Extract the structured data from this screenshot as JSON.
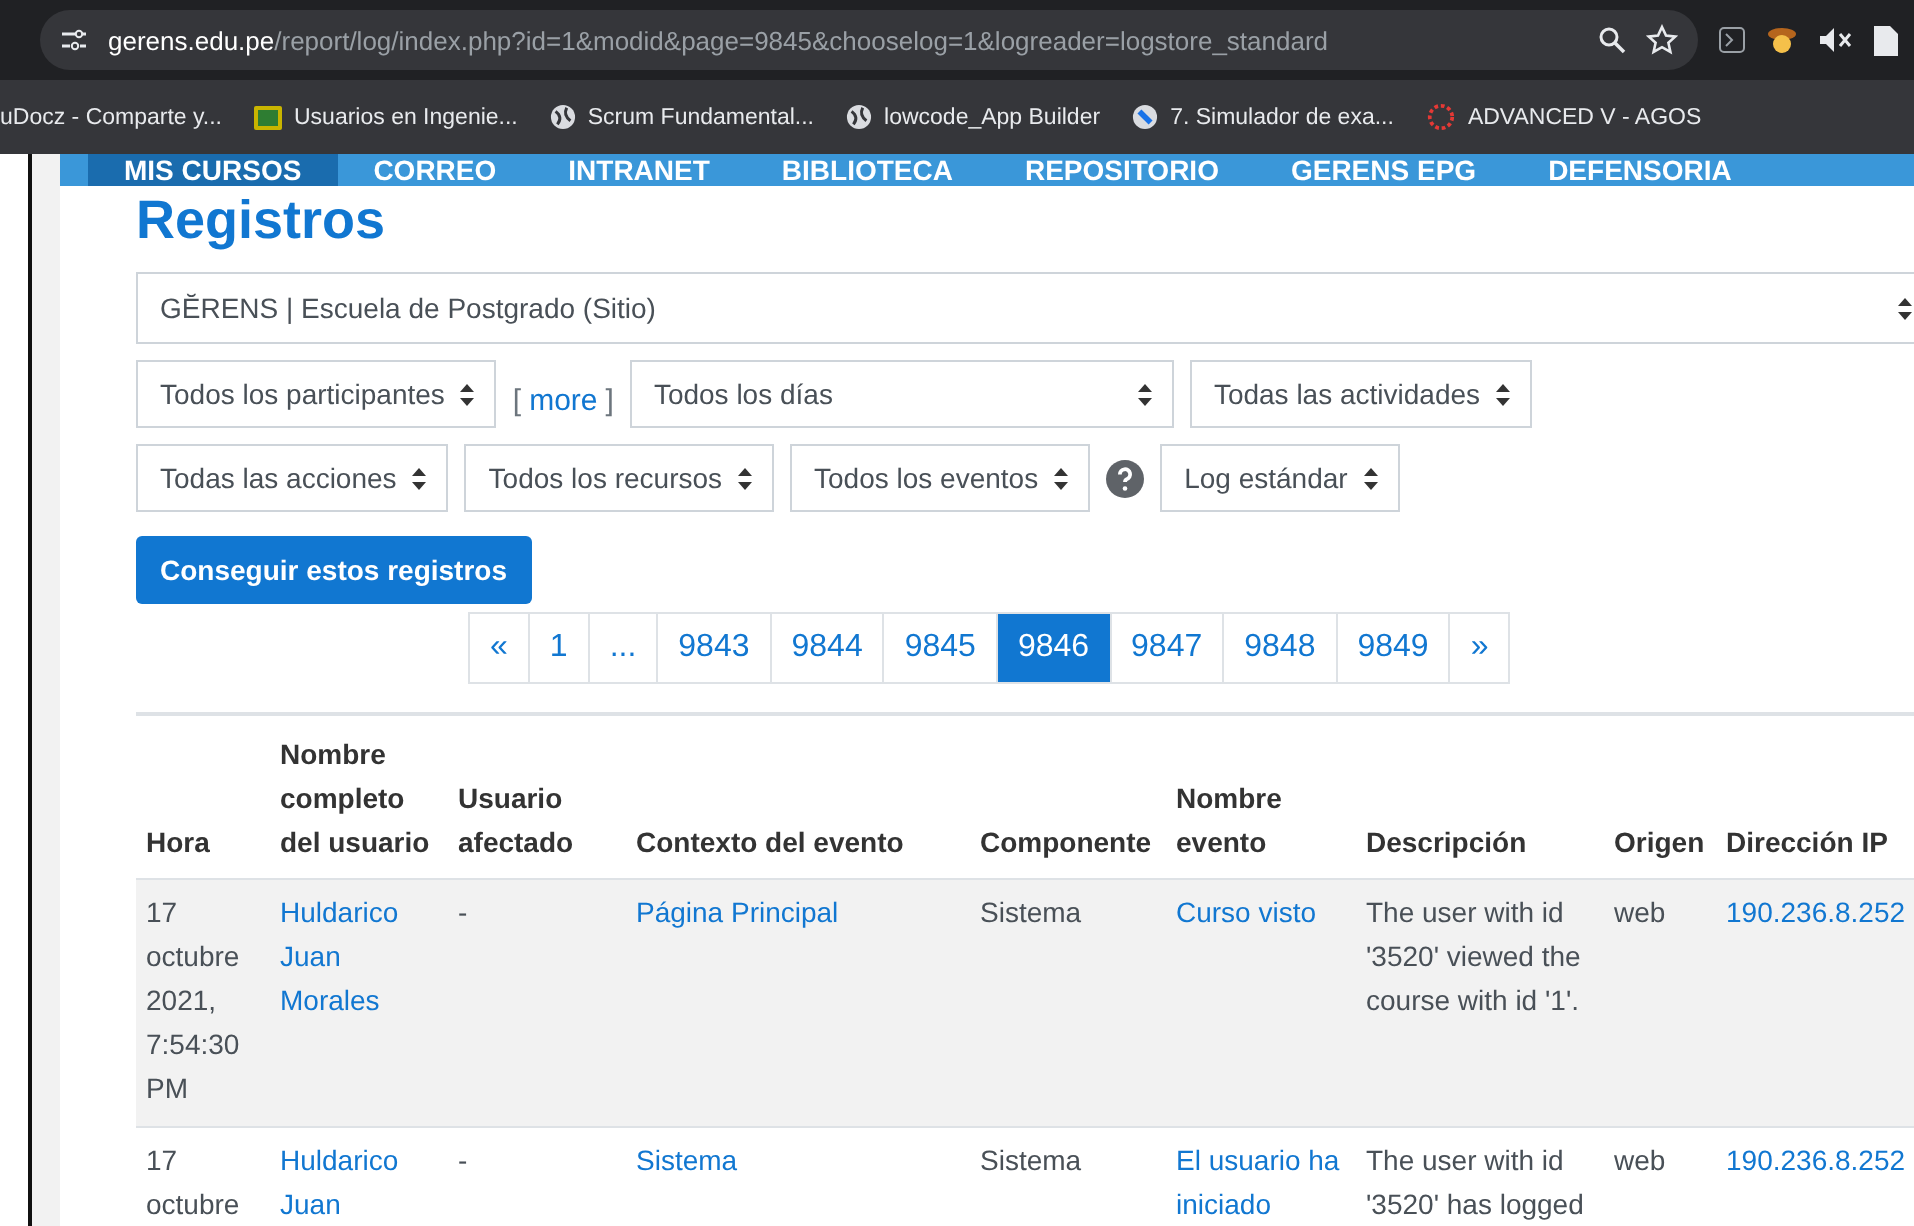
{
  "browser": {
    "address_host": "gerens.edu.pe",
    "address_path": "/report/log/index.php?id=1&modid&page=9845&chooselog=1&logreader=logstore_standard",
    "bookmarks": [
      {
        "label": "uDocz - Comparte y...",
        "kind": "none"
      },
      {
        "label": "Usuarios en Ingenie...",
        "kind": "image"
      },
      {
        "label": "Scrum Fundamental...",
        "kind": "globe"
      },
      {
        "label": "lowcode_App Builder",
        "kind": "globe"
      },
      {
        "label": "7. Simulador de exa...",
        "kind": "disc"
      },
      {
        "label": "ADVANCED V - AGOS",
        "kind": "ring"
      }
    ]
  },
  "nav": [
    {
      "label": "MIS CURSOS",
      "selected": true
    },
    {
      "label": "CORREO",
      "selected": false
    },
    {
      "label": "INTRANET",
      "selected": false
    },
    {
      "label": "BIBLIOTECA",
      "selected": false
    },
    {
      "label": "REPOSITORIO",
      "selected": false
    },
    {
      "label": "GERENS EPG",
      "selected": false
    },
    {
      "label": "DEFENSORIA",
      "selected": false
    }
  ],
  "title": "Registros",
  "site_select": "GĔRENS | Escuela de Postgrado (Sitio)",
  "filter_rows": [
    [
      {
        "kind": "select",
        "label": "Todos los participantes"
      },
      {
        "kind": "link",
        "label": "more",
        "open": "[",
        "close": "]"
      },
      {
        "kind": "wide",
        "label": "Todos los días"
      },
      {
        "kind": "select",
        "label": "Todas las actividades"
      }
    ],
    [
      {
        "kind": "select",
        "label": "Todas las acciones"
      },
      {
        "kind": "select",
        "label": "Todos los recursos"
      },
      {
        "kind": "select",
        "label": "Todos los eventos"
      },
      {
        "kind": "help"
      },
      {
        "kind": "select",
        "label": "Log estándar"
      }
    ]
  ],
  "submit": "Conseguir estos registros",
  "pagination": [
    {
      "label": "«",
      "selected": false
    },
    {
      "label": "1",
      "selected": false
    },
    {
      "label": "...",
      "selected": false
    },
    {
      "label": "9843",
      "selected": false
    },
    {
      "label": "9844",
      "selected": false
    },
    {
      "label": "9845",
      "selected": false
    },
    {
      "label": "9846",
      "selected": true
    },
    {
      "label": "9847",
      "selected": false
    },
    {
      "label": "9848",
      "selected": false
    },
    {
      "label": "9849",
      "selected": false
    },
    {
      "label": "»",
      "selected": false
    }
  ],
  "table": {
    "columns": [
      "Hora",
      "Nombre completo del usuario",
      "Usuario afectado",
      "Contexto del evento",
      "Componente",
      "Nombre evento",
      "Descripción",
      "Origen",
      "Dirección IP"
    ],
    "rows": [
      {
        "shaded": true,
        "cells": [
          {
            "kind": "text",
            "text": "17 octubre 2021, 7:54:30 PM"
          },
          {
            "kind": "link",
            "text": "Huldarico Juan Morales"
          },
          {
            "kind": "text",
            "text": "-"
          },
          {
            "kind": "link",
            "text": "Página Principal"
          },
          {
            "kind": "text",
            "text": "Sistema"
          },
          {
            "kind": "link",
            "text": "Curso visto"
          },
          {
            "kind": "text",
            "text": "The user with id '3520' viewed the course with id '1'."
          },
          {
            "kind": "text",
            "text": "web"
          },
          {
            "kind": "link",
            "text": "190.236.8.252"
          }
        ]
      },
      {
        "shaded": false,
        "cells": [
          {
            "kind": "text",
            "text": "17 octubre"
          },
          {
            "kind": "link",
            "text": "Huldarico Juan"
          },
          {
            "kind": "text",
            "text": "-"
          },
          {
            "kind": "link",
            "text": "Sistema"
          },
          {
            "kind": "text",
            "text": "Sistema"
          },
          {
            "kind": "link",
            "text": "El usuario ha iniciado"
          },
          {
            "kind": "text",
            "text": "The user with id '3520' has logged"
          },
          {
            "kind": "text",
            "text": "web"
          },
          {
            "kind": "link",
            "text": "190.236.8.252"
          }
        ]
      }
    ]
  }
}
